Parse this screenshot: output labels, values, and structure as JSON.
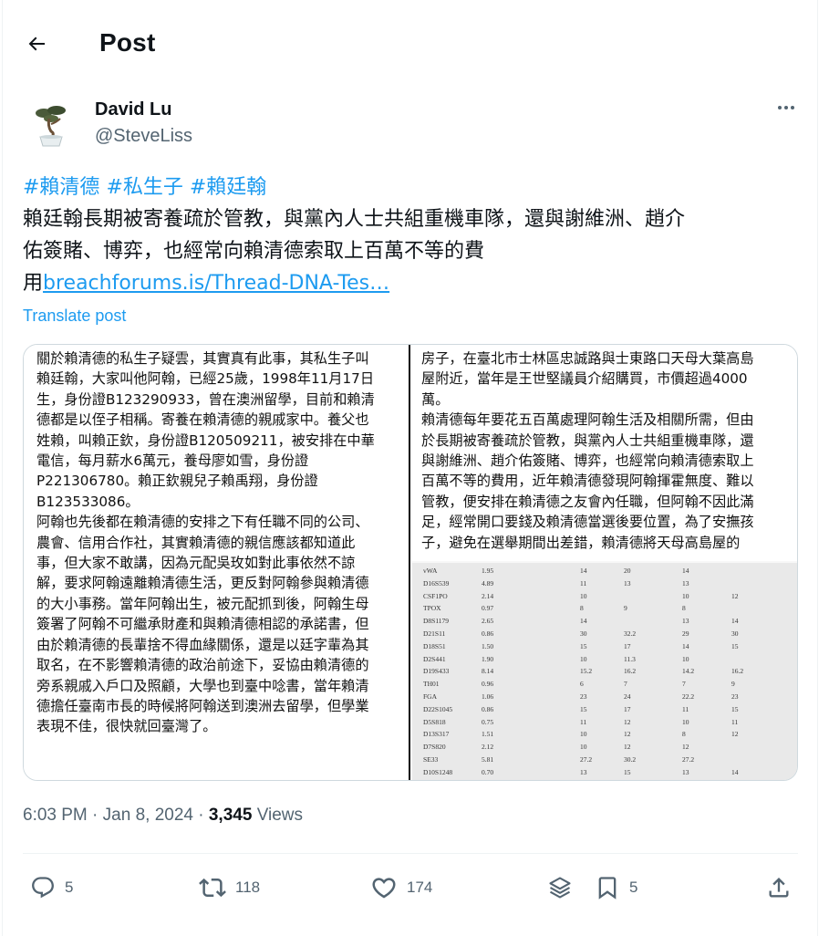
{
  "header": {
    "title": "Post"
  },
  "author": {
    "name": "David Lu",
    "handle": "@SteveLiss"
  },
  "tweet": {
    "hashtags": [
      "#賴清德",
      "#私生子",
      "#賴廷翰"
    ],
    "body_line1": "賴廷翰長期被寄養疏於管教，與黨內人士共組重機車隊，還與謝維洲、趙介",
    "body_line2": "佑簽賭、博弈，也經常向賴清德索取上百萬不等的費",
    "body_line3_prefix": "用",
    "link_text": "breachforums.is/Thread-DNA-Tes…",
    "translate_label": "Translate post"
  },
  "media": {
    "left_text": "關於賴清德的私生子疑雲，其實真有此事，其私生子叫\n賴廷翰，大家叫他阿翰，已經25歲，1998年11月17日\n生，身份證B123290933，曾在澳洲留學，目前和賴清\n德都是以侄子相稱。寄養在賴清德的親戚家中。養父也\n姓賴，叫賴正欽，身份證B120509211，被安排在中華\n電信，每月薪水6萬元，養母廖如雪，身份證\nP221306780。賴正欽親兒子賴禹翔，身份證\nB123533086。\n阿翰也先後都在賴清德的安排之下有任職不同的公司、\n農會、信用合作社，其實賴清德的親信應該都知道此\n事，但大家不敢講，因為元配吳玫如對此事依然不諒\n解，要求阿翰遠離賴清德生活，更反對阿翰參與賴清德\n的大小事務。當年阿翰出生，被元配抓到後，阿翰生母\n簽署了阿翰不可繼承財產和與賴清德相認的承諾書，但\n由於賴清德的長輩捨不得血緣關係，還是以廷字輩為其\n取名，在不影響賴清德的政治前途下，妥協由賴清德的\n旁系親戚入戶口及照顧，大學也到臺中唸書，當年賴清\n德擔任臺南市長的時候將阿翰送到澳洲去留學，但學業\n表現不佳，很快就回臺灣了。",
    "right_text": "房子，在臺北市士林區忠誠路與士東路口天母大葉高島\n屋附近，當年是王世堅議員介紹購買，市價超過4000\n萬。\n賴清德每年要花五百萬處理阿翰生活及相關所需，但由\n於長期被寄養疏於管教，與黨內人士共組重機車隊，還\n與謝維洲、趙介佑簽賭、博弈，也經常向賴清德索取上\n百萬不等的費用，近年賴清德發現阿翰揮霍無度、難以\n管教，便安排在賴清德之友會內任職，但阿翰不因此滿\n足，經常開口要錢及賴清德當選後要位置，為了安撫孩\n子，避免在選舉期間出差錯，賴清德將天母高島屋的",
    "dna_rows": [
      [
        "vWA",
        "1.95",
        "14",
        "20",
        "14",
        ""
      ],
      [
        "D16S539",
        "4.89",
        "11",
        "13",
        "13",
        ""
      ],
      [
        "CSF1PO",
        "2.14",
        "10",
        "",
        "10",
        "12"
      ],
      [
        "TPOX",
        "0.97",
        "8",
        "9",
        "8",
        ""
      ],
      [
        "D8S1179",
        "2.65",
        "14",
        "",
        "13",
        "14"
      ],
      [
        "D21S11",
        "0.86",
        "30",
        "32.2",
        "29",
        "30"
      ],
      [
        "D18S51",
        "1.50",
        "15",
        "17",
        "14",
        "15"
      ],
      [
        "D2S441",
        "1.90",
        "10",
        "11.3",
        "10",
        ""
      ],
      [
        "D19S433",
        "8.14",
        "15.2",
        "16.2",
        "14.2",
        "16.2"
      ],
      [
        "TH01",
        "0.96",
        "6",
        "7",
        "7",
        "9"
      ],
      [
        "FGA",
        "1.06",
        "23",
        "24",
        "22.2",
        "23"
      ],
      [
        "D22S1045",
        "0.86",
        "15",
        "17",
        "11",
        "15"
      ],
      [
        "D5S818",
        "0.75",
        "11",
        "12",
        "10",
        "11"
      ],
      [
        "D13S317",
        "1.51",
        "10",
        "12",
        "8",
        "12"
      ],
      [
        "D7S820",
        "2.12",
        "10",
        "12",
        "12",
        ""
      ],
      [
        "SE33",
        "5.81",
        "27.2",
        "30.2",
        "27.2",
        ""
      ],
      [
        "D10S1248",
        "0.70",
        "13",
        "15",
        "13",
        "14"
      ]
    ]
  },
  "meta": {
    "time": "6:03 PM",
    "sep": "·",
    "date": "Jan 8, 2024",
    "views_count": "3,345",
    "views_label": "Views"
  },
  "actions": {
    "replies": "5",
    "reposts": "118",
    "likes": "174",
    "bookmarks": "5"
  }
}
